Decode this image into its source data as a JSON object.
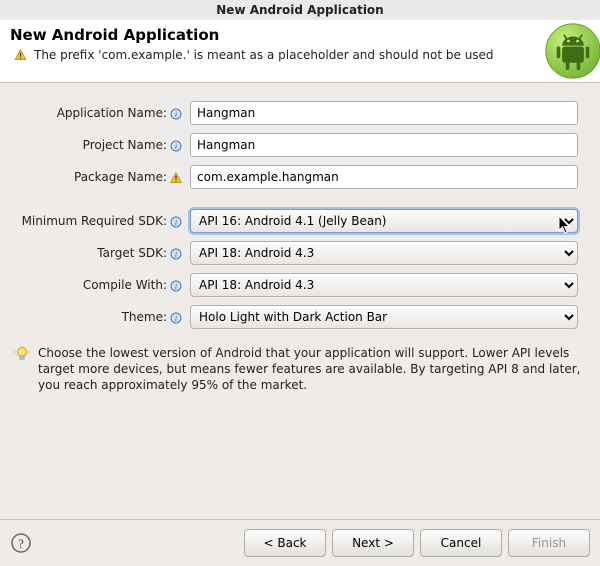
{
  "title": "New Android Application",
  "header": {
    "heading": "New Android Application",
    "warning": "The prefix 'com.example.' is meant as a placeholder and should not be used"
  },
  "fields": {
    "appName": {
      "label": "Application Name:",
      "value": "Hangman"
    },
    "projName": {
      "label": "Project Name:",
      "value": "Hangman"
    },
    "pkgName": {
      "label": "Package Name:",
      "value": "com.example.hangman"
    },
    "minSdk": {
      "label": "Minimum Required SDK:",
      "value": "API 16: Android 4.1 (Jelly Bean)"
    },
    "targetSdk": {
      "label": "Target SDK:",
      "value": "API 18: Android 4.3"
    },
    "compile": {
      "label": "Compile With:",
      "value": "API 18: Android 4.3"
    },
    "theme": {
      "label": "Theme:",
      "value": "Holo Light with Dark Action Bar"
    }
  },
  "hint": "Choose the lowest version of Android that your application will support. Lower API levels target more devices, but means fewer features are available. By targeting API 8 and later, you reach approximately 95% of the market.",
  "buttons": {
    "back": "< Back",
    "next": "Next >",
    "cancel": "Cancel",
    "finish": "Finish"
  }
}
